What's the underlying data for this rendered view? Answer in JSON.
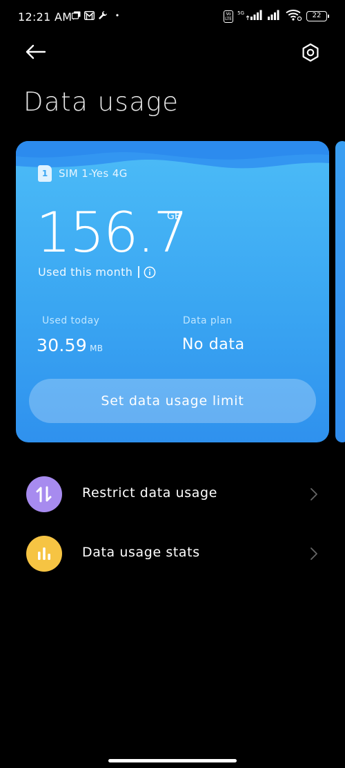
{
  "status_bar": {
    "time": "12:21 AM",
    "network_label": "5G",
    "battery": "22"
  },
  "header": {
    "title": "Data usage"
  },
  "card": {
    "sim_number": "1",
    "sim_label": "SIM 1-Yes 4G",
    "used_value": "156.7",
    "used_unit": "GB",
    "used_label": "Used this month",
    "today_label": "Used today",
    "today_value": "30.59",
    "today_unit": "MB",
    "plan_label": "Data plan",
    "plan_value": "No data",
    "limit_button_label": "Set data usage limit",
    "accent_color": "#3aa6f2"
  },
  "list": [
    {
      "label": "Restrict data usage",
      "icon": "arrows-up-down-icon",
      "color": "#a78bef"
    },
    {
      "label": "Data usage stats",
      "icon": "bar-chart-icon",
      "color": "#f6c443"
    }
  ]
}
